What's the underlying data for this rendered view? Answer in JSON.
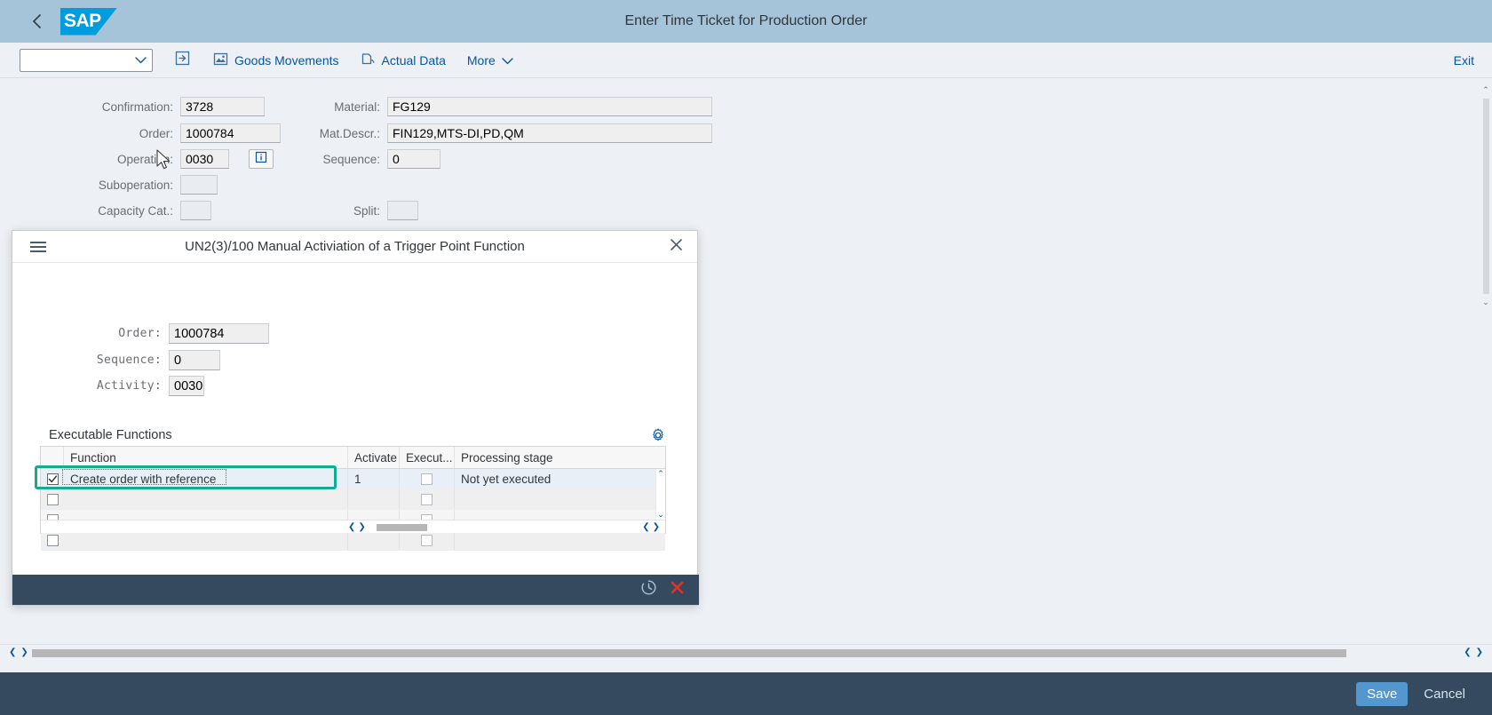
{
  "shell": {
    "back_icon": "chevron-left-icon",
    "logo_text": "SAP",
    "title": "Enter Time Ticket for Production Order"
  },
  "toolbar": {
    "select_value": "",
    "select_placeholder": "",
    "transfer_icon": "transfer-icon",
    "items": [
      {
        "label": "Goods Movements",
        "icon": "picture-icon"
      },
      {
        "label": "Actual Data",
        "icon": "copy-icon"
      },
      {
        "label": "More",
        "icon": "chevron-down-icon"
      }
    ],
    "exit_label": "Exit"
  },
  "form": {
    "left": [
      {
        "label": "Confirmation:",
        "value": "3728"
      },
      {
        "label": "Order:",
        "value": "1000784"
      },
      {
        "label": "Operation:",
        "value": "0030"
      },
      {
        "label": "Suboperation:",
        "value": ""
      },
      {
        "label": "Capacity Cat.:",
        "value": ""
      }
    ],
    "right": [
      {
        "label": "Material:",
        "value": "FG129"
      },
      {
        "label": "Mat.Descr.:",
        "value": "FIN129,MTS-DI,PD,QM"
      },
      {
        "label": "Sequence:",
        "value": "0"
      },
      {
        "label": "Split:",
        "value": ""
      }
    ],
    "info_icon": "info-icon"
  },
  "dialog": {
    "burger_icon": "menu-icon",
    "title": "UN2(3)/100 Manual Activiation of a Trigger Point Function",
    "close_icon": "close-icon",
    "fields": [
      {
        "label": "Order:",
        "value": "1000784"
      },
      {
        "label": "Sequence:",
        "value": "0"
      },
      {
        "label": "Activity:",
        "value": "0030"
      }
    ],
    "section_title": "Executable Functions",
    "settings_icon": "gear-icon",
    "table": {
      "columns": [
        "",
        "Function",
        "Activate",
        "Execut...",
        "Processing stage"
      ],
      "rows": [
        {
          "selected": true,
          "checked": true,
          "function": "Create order with reference",
          "activate": "1",
          "executed": false,
          "processing_stage": "Not yet executed"
        },
        {
          "selected": false,
          "checked": false,
          "function": "",
          "activate": "",
          "executed": false,
          "processing_stage": ""
        },
        {
          "selected": false,
          "checked": false,
          "function": "",
          "activate": "",
          "executed": false,
          "processing_stage": ""
        },
        {
          "selected": false,
          "checked": false,
          "function": "",
          "activate": "",
          "executed": false,
          "processing_stage": ""
        }
      ]
    },
    "footer": {
      "history_icon": "clock-history-icon",
      "cancel_icon": "red-x-icon"
    }
  },
  "bottombar": {
    "save_label": "Save",
    "cancel_label": "Cancel"
  },
  "colors": {
    "shell_bg": "#A5C4DA",
    "accent_link": "#0854A0",
    "selection_ring": "#12AD8E",
    "footer_bg": "#354A5F",
    "save_btn": "#5496CE",
    "sap_blue": "#009CDE"
  }
}
